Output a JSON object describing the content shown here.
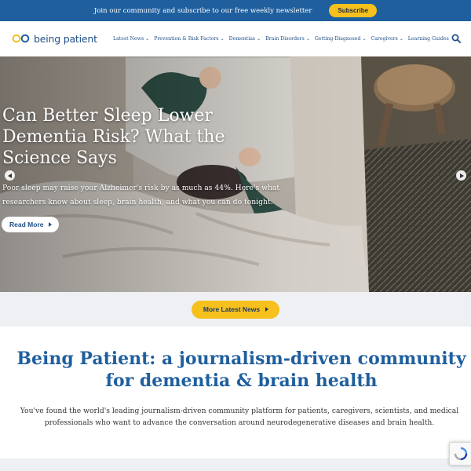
{
  "banner": {
    "text": "Join our community and subscribe to our free weekly newsletter",
    "subscribe_label": "Subscribe"
  },
  "nav": {
    "logo_text": "being patient",
    "items": [
      {
        "label": "Latest News",
        "has_dropdown": true
      },
      {
        "label": "Prevention & Risk Factors",
        "has_dropdown": true
      },
      {
        "label": "Dementias",
        "has_dropdown": true
      },
      {
        "label": "Brain Disorders",
        "has_dropdown": true
      },
      {
        "label": "Getting Diagnosed",
        "has_dropdown": true
      },
      {
        "label": "Caregivers",
        "has_dropdown": true
      },
      {
        "label": "Learning Guides",
        "has_dropdown": false
      }
    ],
    "search_icon": "search-icon"
  },
  "hero": {
    "title": "Can Better Sleep Lower Dementia Risk? What the Science Says",
    "subtitle": "Poor sleep may raise your Alzheimer's risk by as much as 44%. Here's what researchers know about sleep, brain health, and what you can do tonight.",
    "read_more_label": "Read More",
    "prev_icon": "chevron-left-icon",
    "next_icon": "chevron-right-icon"
  },
  "latest": {
    "button_label": "More Latest News"
  },
  "intro": {
    "title": "Being Patient: a journalism-driven community for dementia & brain health",
    "text": "You've found the world's leading journalism-driven community platform for patients, caregivers, scientists, and medical professionals who want to advance the conversation around neurodegenerative diseases and brain health."
  },
  "colors": {
    "brand_blue": "#1f5f9e",
    "accent_yellow": "#f6c01d"
  }
}
